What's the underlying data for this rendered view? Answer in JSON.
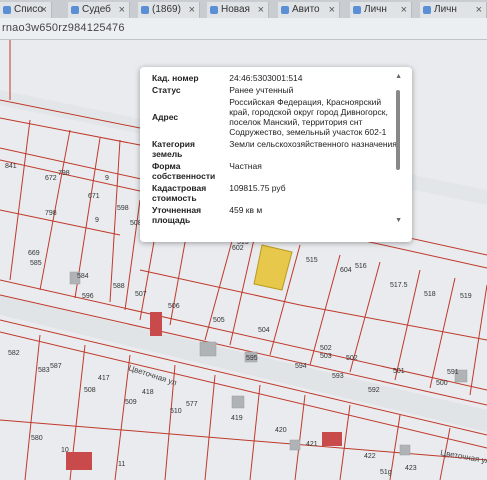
{
  "browser": {
    "tabs": [
      {
        "label": "Списо"
      },
      {
        "label": "Судеб"
      },
      {
        "label": "(1869)"
      },
      {
        "label": "Новая"
      },
      {
        "label": "Авито"
      },
      {
        "label": "Личн"
      },
      {
        "label": "Личн"
      }
    ],
    "address": "rnao3w650rz984125476"
  },
  "map": {
    "plot_labels": [
      "841",
      "672",
      "798",
      "671",
      "9",
      "798",
      "9",
      "598",
      "508",
      "669",
      "585",
      "584",
      "596",
      "588",
      "507",
      "506",
      "505",
      "504",
      "595",
      "594",
      "503",
      "602",
      "513",
      "515",
      "604",
      "516",
      "517.5",
      "518",
      "519",
      "582",
      "583",
      "587",
      "417",
      "508",
      "418",
      "509",
      "510",
      "577",
      "419",
      "420",
      "421",
      "593",
      "502",
      "592",
      "501",
      "500",
      "591",
      "580",
      "10",
      "11",
      "422",
      "423",
      "51g",
      "502"
    ],
    "street_name": "Цветочная ул",
    "street_name_right": "Цветочная ул"
  },
  "popup": {
    "rows": [
      {
        "key": "Кад. номер",
        "value": "24:46:5303001:514"
      },
      {
        "key": "Статус",
        "value": "Ранее учтенный"
      },
      {
        "key": "Адрес",
        "value": "Российская Федерация, Красноярский край, городской округ город Дивногорск, поселок Манский, территория снт Содружество, земельный участок 602-1"
      },
      {
        "key": "Категория земель",
        "value": "Земли сельскохозяйственного назначения"
      },
      {
        "key": "Форма собственности",
        "value": "Частная"
      },
      {
        "key": "Кадастровая стоимость",
        "value": "109815.75 руб"
      },
      {
        "key": "Уточненная площадь",
        "value": "459 кв м"
      }
    ]
  },
  "colors": {
    "plot_border": "#c0392b",
    "selected_plot": "#e8c84a",
    "building": "#b0b3b6",
    "highlight_building": "#c84a4a"
  }
}
